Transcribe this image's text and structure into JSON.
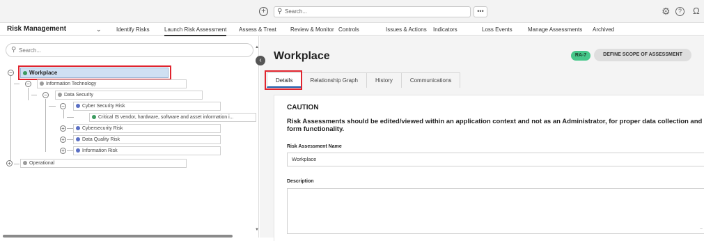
{
  "topbar": {
    "add_icon": "plus-circle-icon",
    "search_placeholder": "Search...",
    "more_label": "•••",
    "icons": [
      "gear-icon",
      "help-icon",
      "user-icon"
    ]
  },
  "navbar": {
    "app_title": "Risk Management",
    "items": [
      "Identify Risks",
      "Launch Risk Assessment",
      "Assess & Treat",
      "Review & Monitor",
      "Controls",
      "Issues & Actions",
      "Indicators",
      "Loss Events",
      "Manage Assessments",
      "Archived"
    ],
    "active_item": "Launch Risk Assessment"
  },
  "tree": {
    "search_placeholder": "Search...",
    "nodes": [
      {
        "label": "Workplace",
        "level": 0,
        "dot": "#3c9a5f",
        "toggle": "−",
        "selected": true
      },
      {
        "label": "Information Technology",
        "level": 1,
        "dot": "#9a9a9a",
        "toggle": "−"
      },
      {
        "label": "Data Security",
        "level": 2,
        "dot": "#9a9a9a",
        "toggle": "−"
      },
      {
        "label": "Cyber Security Risk",
        "level": 3,
        "dot": "#5a6fc4",
        "toggle": "−"
      },
      {
        "label": "Critical IS vendor, hardware, software and asset information i...",
        "level": 4,
        "dot": "#3c9a5f",
        "toggle": ""
      },
      {
        "label": "Cybersecurity Risk",
        "level": 3,
        "dot": "#5a6fc4",
        "toggle": "+"
      },
      {
        "label": "Data Quality Risk",
        "level": 3,
        "dot": "#5a6fc4",
        "toggle": "+"
      },
      {
        "label": "Information Risk",
        "level": 3,
        "dot": "#5a6fc4",
        "toggle": "+"
      },
      {
        "label": "Operational",
        "level": 1,
        "dot": "#9a9a9a",
        "toggle": "+"
      }
    ]
  },
  "record": {
    "title": "Workplace",
    "id_badge": "RA-7",
    "workflow_button": "DEFINE SCOPE OF ASSESSMENT",
    "tabs": [
      "Details",
      "Relationship Graph",
      "History",
      "Communications"
    ],
    "active_tab": "Details",
    "caution_title": "CAUTION",
    "caution_text": "Risk Assessments should be edited/viewed within an application context and not as an Administrator, for proper data collection and form functionality.",
    "fields": {
      "name_label": "Risk Assessment Name",
      "name_value": "Workplace",
      "description_label": "Description",
      "description_value": ""
    }
  },
  "colors": {
    "highlight_border": "#e0242e",
    "badge": "#46c78a",
    "selected_node": "#cfe0f3"
  }
}
